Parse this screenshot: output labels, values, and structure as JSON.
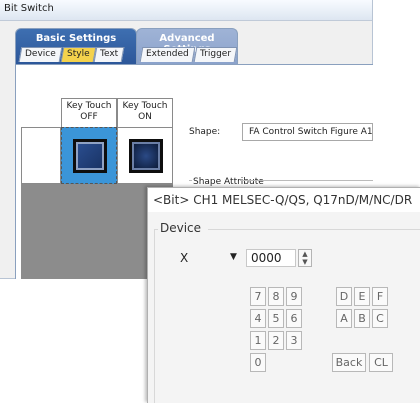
{
  "dialog1": {
    "title": "Bit Switch",
    "tab_groups": [
      {
        "title": "Basic Settings",
        "subtabs": [
          "Device",
          "Style",
          "Text"
        ],
        "active": "Style"
      },
      {
        "title": "Advanced Settings",
        "subtabs": [
          "Extended",
          "Trigger"
        ]
      }
    ],
    "preview": {
      "key_touch_off_line1": "Key Touch",
      "key_touch_off_line2": "OFF",
      "key_touch_on_line1": "Key Touch",
      "key_touch_on_line2": "ON"
    },
    "shape_label": "Shape:",
    "shape_value": "FA Control Switch Figure A1 :",
    "shape_attribute_label": "Shape Attribute"
  },
  "dialog2": {
    "title": "<Bit> CH1 MELSEC-Q/QS, Q17nD/M/NC/DR",
    "device_group_label": "Device",
    "device_type": "X",
    "device_number": "0000",
    "keypad": [
      "7",
      "8",
      "9",
      "D",
      "E",
      "F",
      "4",
      "5",
      "6",
      "A",
      "B",
      "C",
      "1",
      "2",
      "3",
      "0",
      "Back",
      "CL"
    ]
  },
  "icons": {
    "dropdown": "chevron-down-icon",
    "spinner": "spinner-icon"
  },
  "colors": {
    "basic_tab": "#3e6fb1",
    "advanced_tab": "#9fb3d6",
    "active_subtab": "#f4d24c",
    "selected_cell": "#3b95d8"
  }
}
